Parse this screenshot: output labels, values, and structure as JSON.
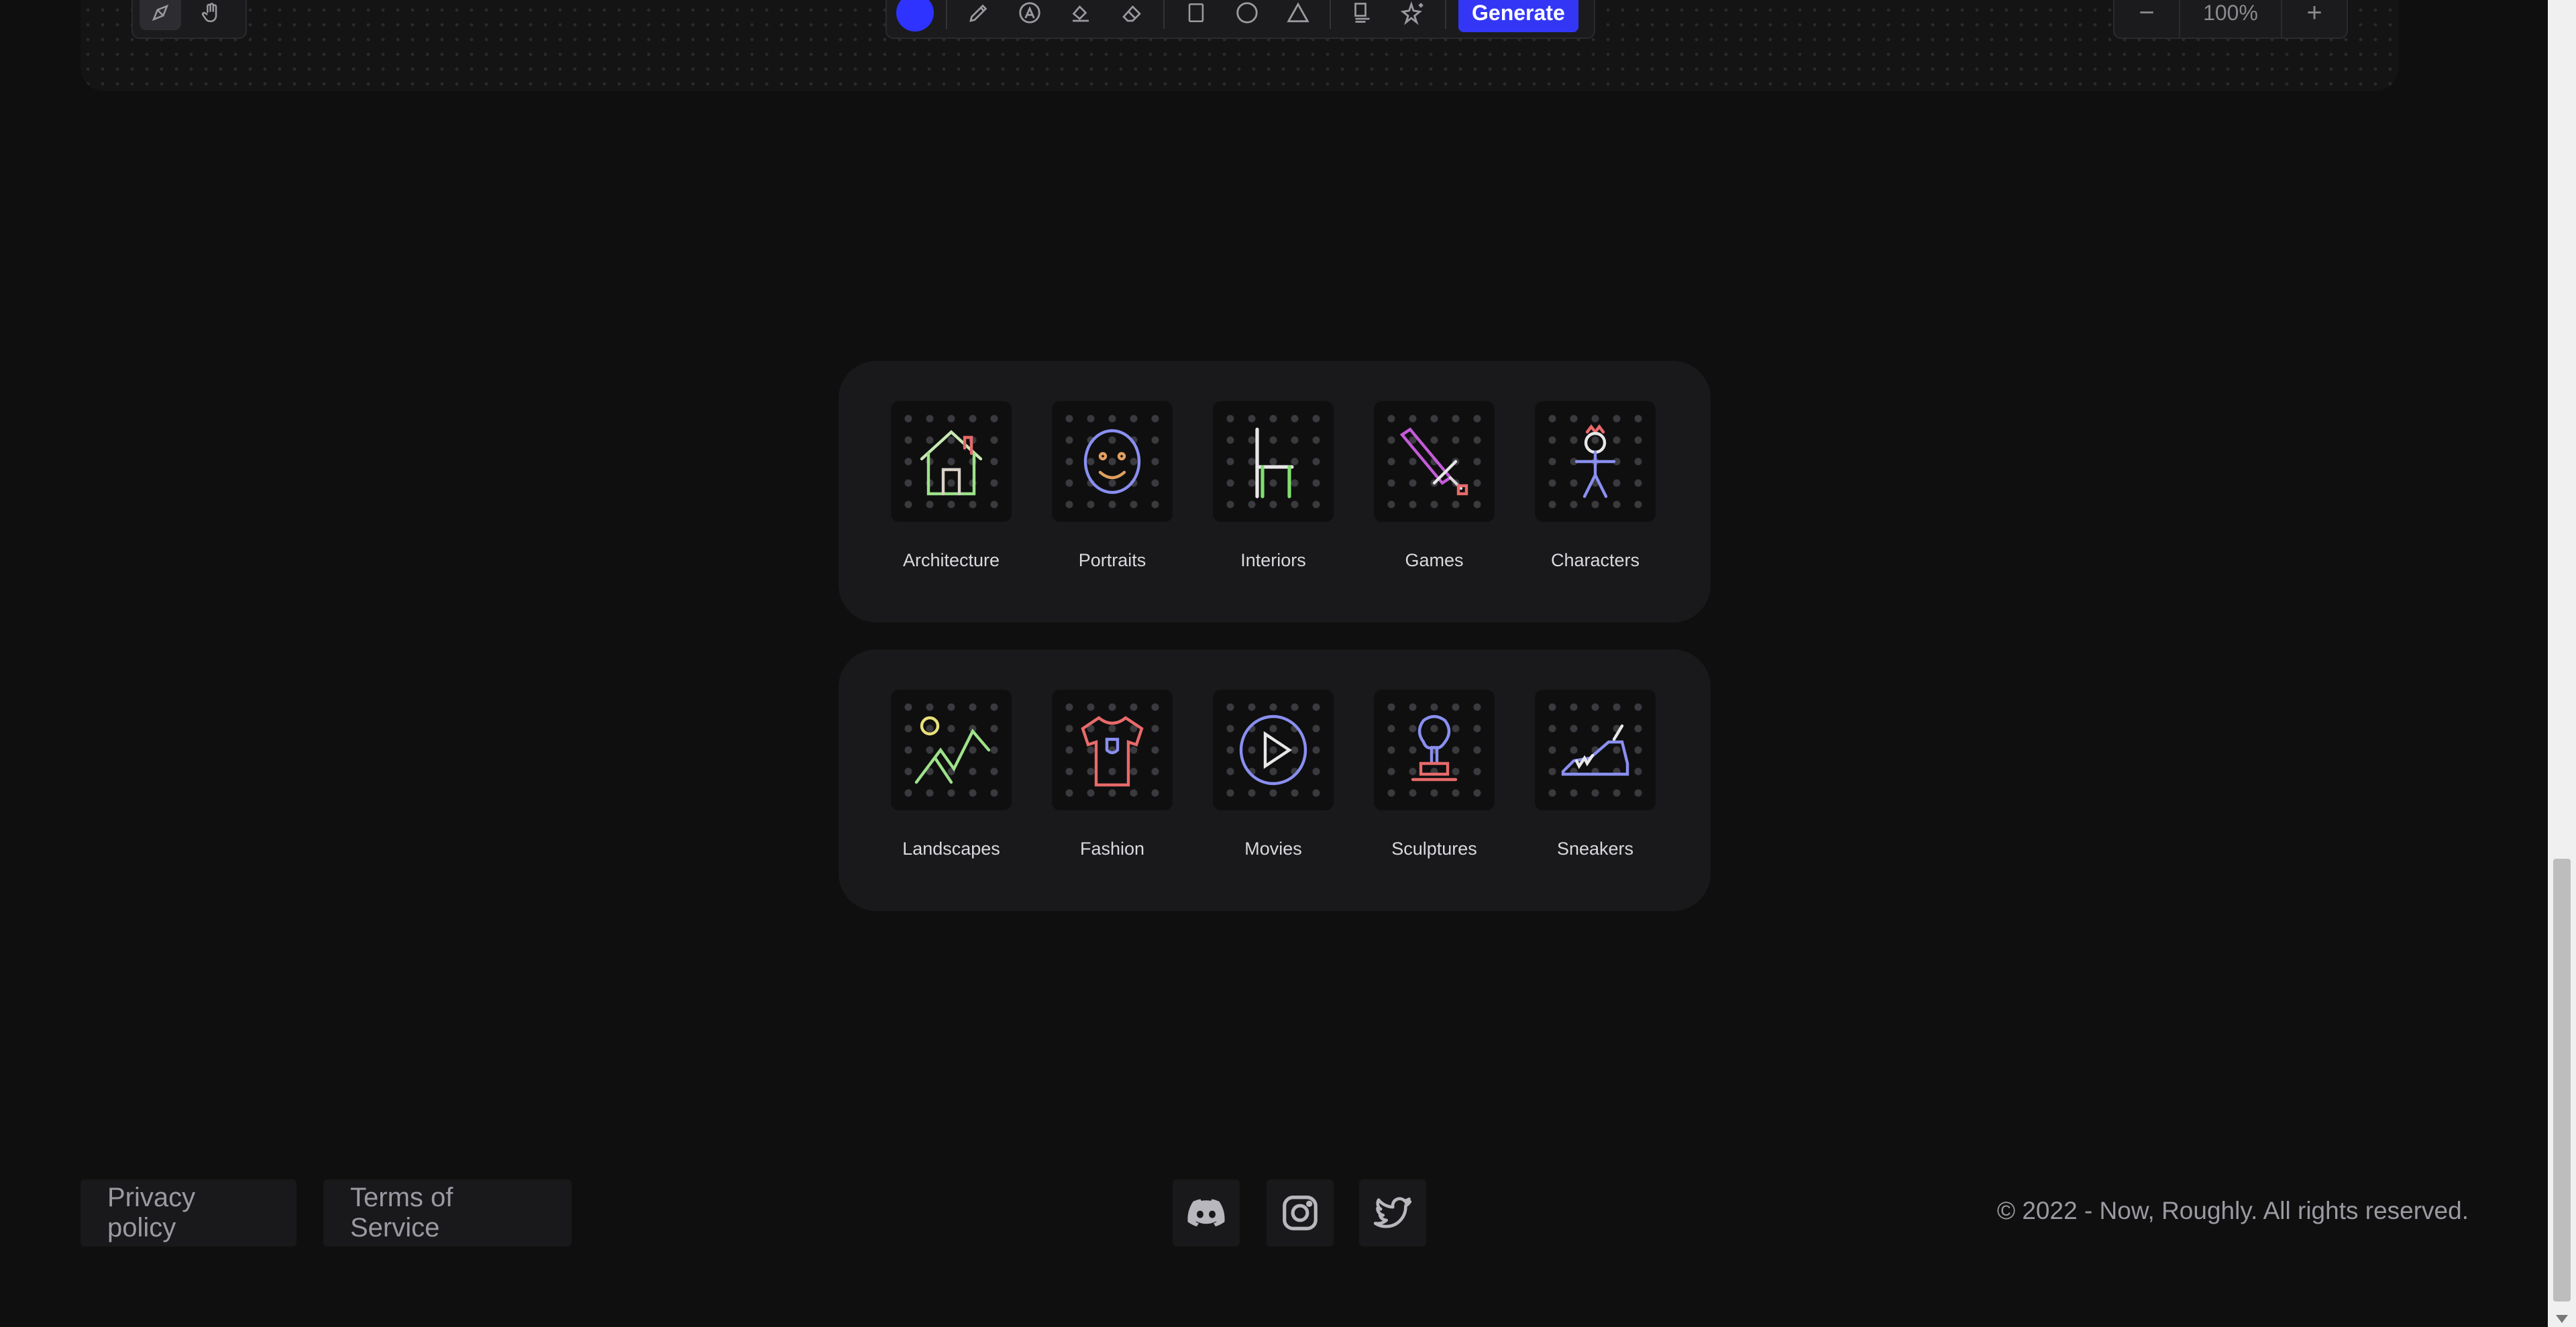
{
  "toolbar": {
    "active_color": "#2e33ff",
    "generate_label": "Generate",
    "tools": [
      "select-icon",
      "hand-icon",
      "pencil-icon",
      "pen-icon",
      "fill-icon",
      "eraser-icon",
      "rectangle-icon",
      "circle-icon",
      "triangle-icon",
      "text-icon",
      "sparkle-icon"
    ]
  },
  "zoom": {
    "minus": "−",
    "value": "100%",
    "plus": "+"
  },
  "categories": {
    "row1": [
      {
        "label": "Architecture",
        "icon": "house-icon"
      },
      {
        "label": "Portraits",
        "icon": "face-icon"
      },
      {
        "label": "Interiors",
        "icon": "chair-icon"
      },
      {
        "label": "Games",
        "icon": "sword-icon"
      },
      {
        "label": "Characters",
        "icon": "stick-figure-icon"
      }
    ],
    "row2": [
      {
        "label": "Landscapes",
        "icon": "mountains-icon"
      },
      {
        "label": "Fashion",
        "icon": "tshirt-icon"
      },
      {
        "label": "Movies",
        "icon": "play-icon"
      },
      {
        "label": "Sculptures",
        "icon": "bust-icon"
      },
      {
        "label": "Sneakers",
        "icon": "sneaker-icon"
      }
    ]
  },
  "footer": {
    "privacy": "Privacy policy",
    "terms": "Terms of Service",
    "social": [
      "discord-icon",
      "instagram-icon",
      "twitter-icon"
    ],
    "copyright": "© 2022 - Now, Roughly. All rights reserved."
  }
}
